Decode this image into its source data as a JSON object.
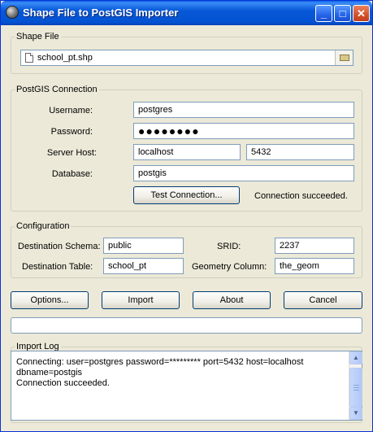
{
  "window": {
    "title": "Shape File to PostGIS Importer",
    "minimize_glyph": "_",
    "maximize_glyph": "□",
    "close_glyph": "✕"
  },
  "shape_file": {
    "legend": "Shape File",
    "path": "school_pt.shp",
    "icons": [
      "document-icon",
      "folder-icon"
    ]
  },
  "connection": {
    "legend": "PostGIS Connection",
    "username_label": "Username:",
    "username": "postgres",
    "password_label": "Password:",
    "password_masked": "●●●●●●●●",
    "host_label": "Server Host:",
    "host": "localhost",
    "port": "5432",
    "database_label": "Database:",
    "database": "postgis",
    "test_button": "Test Connection...",
    "status": "Connection succeeded."
  },
  "configuration": {
    "legend": "Configuration",
    "schema_label": "Destination Schema:",
    "schema": "public",
    "srid_label": "SRID:",
    "srid": "2237",
    "table_label": "Destination Table:",
    "table": "school_pt",
    "geom_label": "Geometry Column:",
    "geom": "the_geom"
  },
  "actions": {
    "options": "Options...",
    "import": "Import",
    "about": "About",
    "cancel": "Cancel"
  },
  "progress": {
    "value": 0
  },
  "log": {
    "legend": "Import Log",
    "lines": [
      "Connecting:  user=postgres password=********* port=5432 host=localhost",
      "dbname=postgis",
      "Connection succeeded."
    ]
  },
  "colors": {
    "titlebar": "#0758d8",
    "window_bg": "#ece9d8",
    "field_border": "#7f9db9",
    "button_border": "#003c74"
  }
}
